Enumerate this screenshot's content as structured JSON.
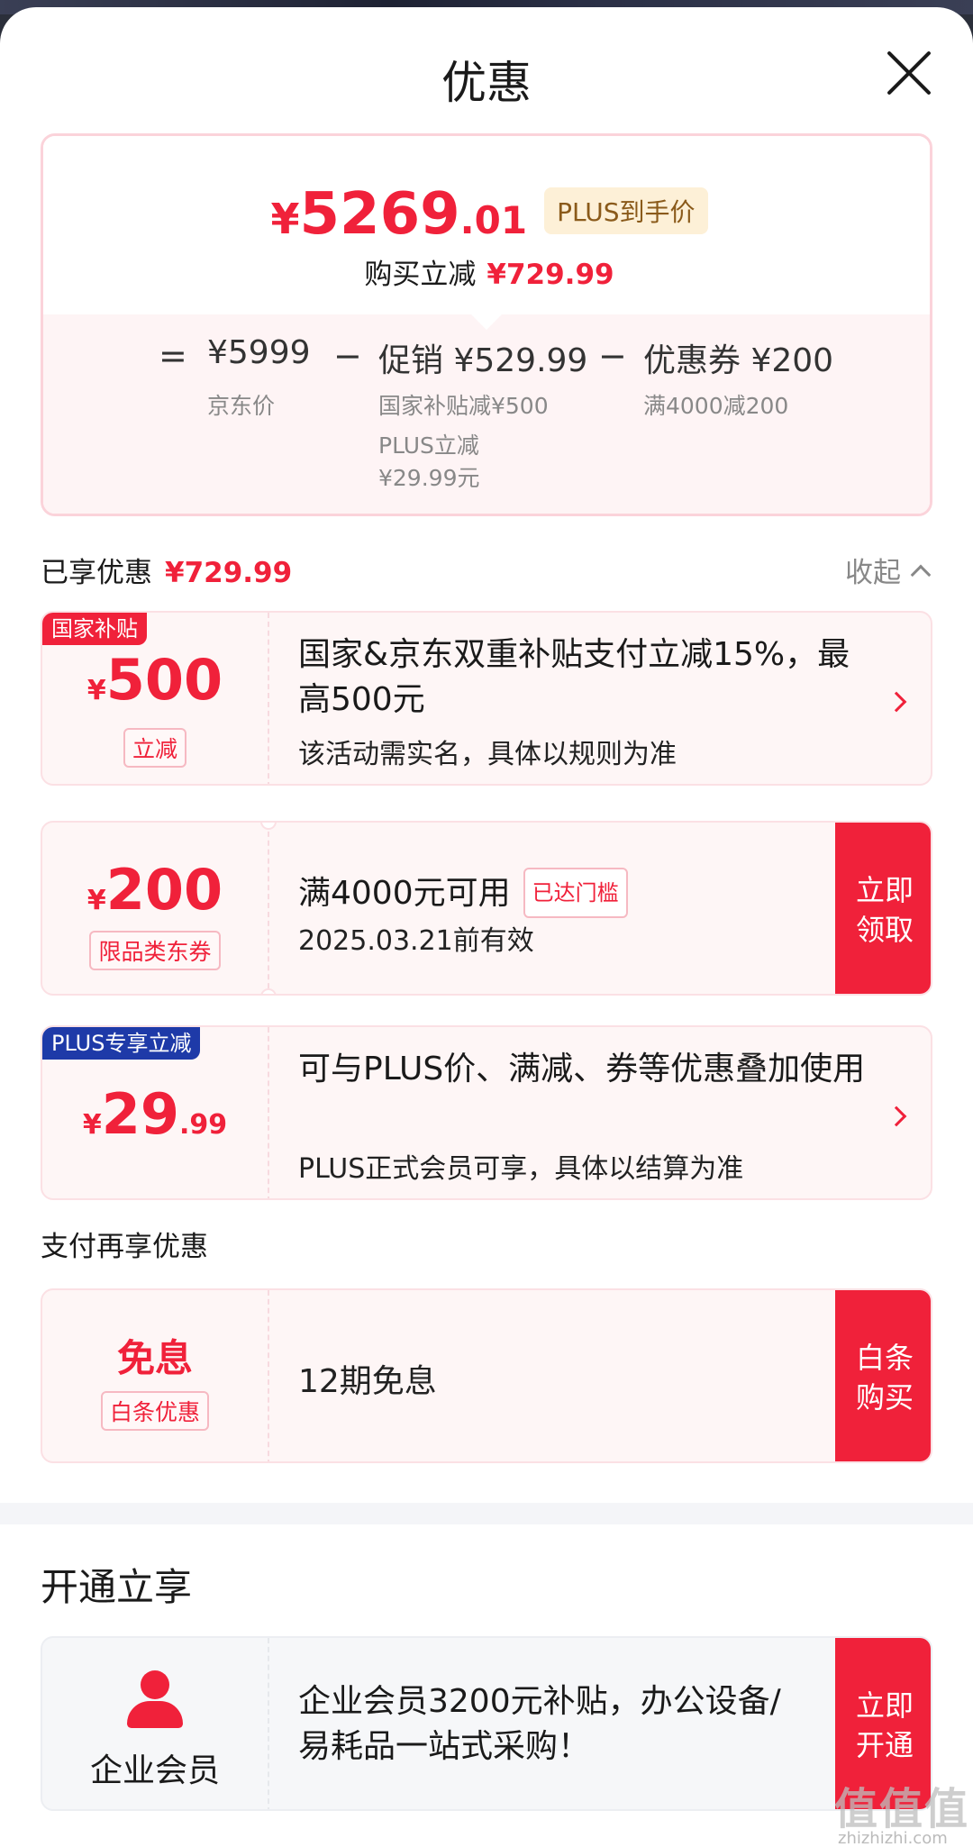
{
  "sheet": {
    "title": "优惠",
    "close_icon": "close-icon"
  },
  "summary": {
    "price_symbol": "¥",
    "price_integer": "5269",
    "price_decimal": ".01",
    "plus_tag": "PLUS到手价",
    "save_label": "购买立减",
    "save_amount": "¥729.99",
    "equals": "=",
    "minus": "−",
    "jd_price": "¥5999",
    "jd_price_label": "京东价",
    "promo_label": "促销",
    "promo_amount": "¥529.99",
    "promo_detail_1": "国家补贴减¥500",
    "promo_detail_2": "PLUS立减",
    "promo_detail_3": "¥29.99元",
    "coupon_label": "优惠券",
    "coupon_amount": "¥200",
    "coupon_detail": "满4000减200"
  },
  "enjoyed": {
    "label": "已享优惠",
    "amount": "¥729.99",
    "collapse": "收起"
  },
  "cards": {
    "subsidy": {
      "tag": "国家补贴",
      "symbol": "¥",
      "amount": "500",
      "pill": "立减",
      "title": "国家&京东双重补贴支付立减15%，最高500元",
      "subtitle": "该活动需实名，具体以规则为准"
    },
    "coupon": {
      "symbol": "¥",
      "amount": "200",
      "pill": "限品类东券",
      "title": "满4000元可用",
      "reached": "已达门槛",
      "subtitle": "2025.03.21前有效",
      "action_1": "立即",
      "action_2": "领取"
    },
    "plus": {
      "tag": "PLUS专享立减",
      "symbol": "¥",
      "amount": "29",
      "decimal": ".99",
      "title": "可与PLUS价、满减、券等优惠叠加使用",
      "subtitle": "PLUS正式会员可享，具体以结算为准"
    },
    "baitiao": {
      "title": "免息",
      "pill": "白条优惠",
      "desc": "12期免息",
      "action_1": "白条",
      "action_2": "购买"
    },
    "enterprise": {
      "label": "企业会员",
      "desc": "企业会员3200元补贴，办公设备/易耗品一站式采购！",
      "action_1": "立即",
      "action_2": "开通"
    }
  },
  "pay_section": {
    "label": "支付再享优惠"
  },
  "open_section": {
    "title": "开通立享"
  },
  "watermark": {
    "main": "值值值",
    "sub": "zhizhizhi.com"
  },
  "colors": {
    "accent": "#f0213a",
    "plus_blue": "#1e3aa8",
    "gold_bg": "#fdf0d7"
  }
}
